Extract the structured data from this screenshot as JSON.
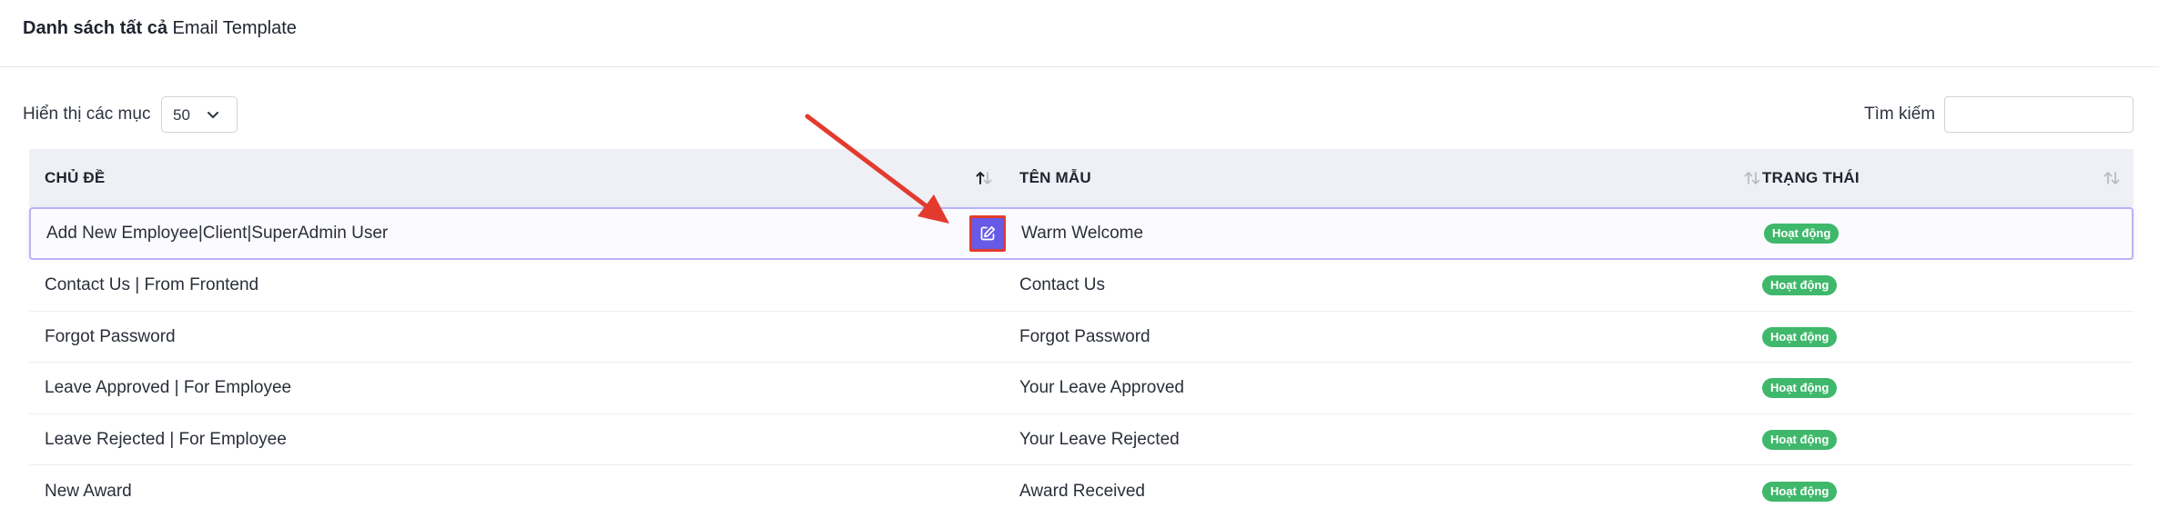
{
  "page": {
    "title_strong": "Danh sách tất cả",
    "title_rest": " Email Template"
  },
  "controls": {
    "show_label": "Hiển thị các mục",
    "page_size": "50",
    "search_label": "Tìm kiếm",
    "search_value": "",
    "search_placeholder": ""
  },
  "table": {
    "columns": [
      {
        "label": "CHỦ ĐỀ",
        "sort_state": "ascending"
      },
      {
        "label": "TÊN MẪU",
        "sort_state": "none"
      },
      {
        "label": "TRẠNG THÁI",
        "sort_state": "none"
      }
    ],
    "rows": [
      {
        "subject": "Add New Employee|Client|SuperAdmin User",
        "name": "Warm Welcome",
        "status": "Hoạt động",
        "selected": true
      },
      {
        "subject": "Contact Us | From Frontend",
        "name": "Contact Us",
        "status": "Hoạt động"
      },
      {
        "subject": "Forgot Password",
        "name": "Forgot Password",
        "status": "Hoạt động"
      },
      {
        "subject": "Leave Approved | For Employee",
        "name": "Your Leave Approved",
        "status": "Hoạt động"
      },
      {
        "subject": "Leave Rejected | For Employee",
        "name": "Your Leave Rejected",
        "status": "Hoạt động"
      },
      {
        "subject": "New Award",
        "name": "Award Received",
        "status": "Hoạt động"
      }
    ],
    "row_actions": {
      "edit_icon": "edit-icon"
    }
  },
  "annotation": {
    "arrow_color": "#e23b2e",
    "highlight_color": "#e23b2e"
  },
  "colors": {
    "accent": "#675ae6",
    "status_active": "#3fb86b",
    "header_bg": "#eff0f5"
  }
}
